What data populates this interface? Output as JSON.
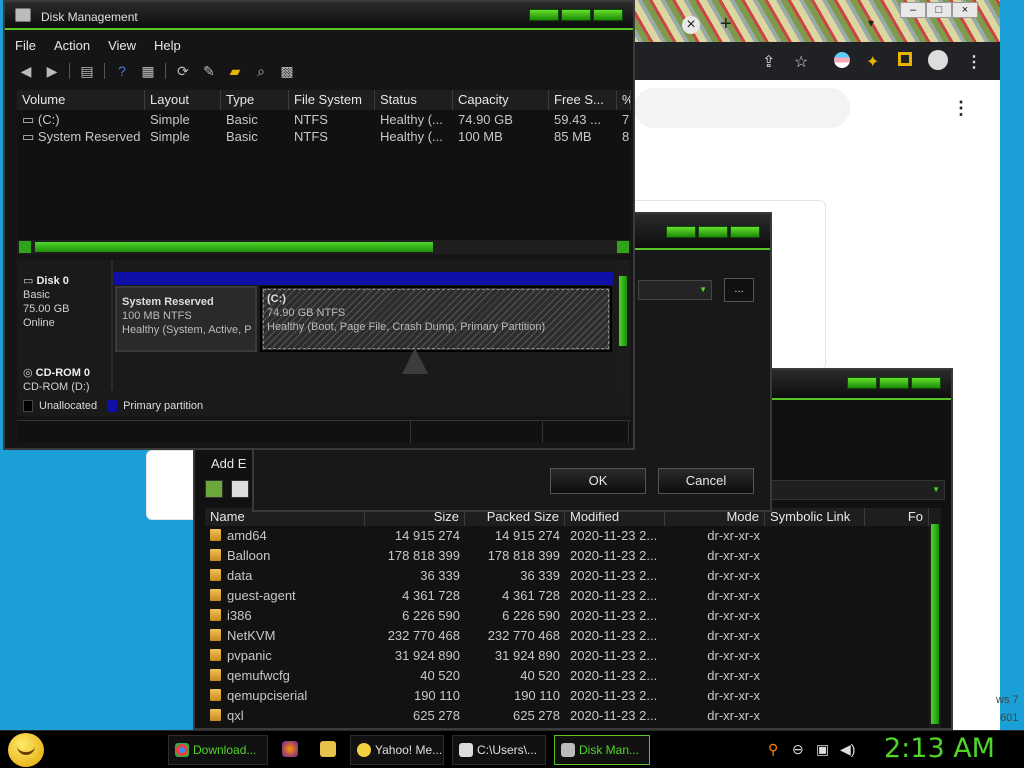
{
  "disk_management": {
    "title": "Disk Management",
    "menu": [
      "File",
      "Action",
      "View",
      "Help"
    ],
    "columns": [
      "Volume",
      "Layout",
      "Type",
      "File System",
      "Status",
      "Capacity",
      "Free S...",
      "%"
    ],
    "rows": [
      [
        "(C:)",
        "Simple",
        "Basic",
        "NTFS",
        "Healthy (...",
        "74.90 GB",
        "59.43 ...",
        "7"
      ],
      [
        "System Reserved",
        "Simple",
        "Basic",
        "NTFS",
        "Healthy (...",
        "100 MB",
        "85 MB",
        "8"
      ]
    ],
    "disk0": {
      "name": "Disk 0",
      "type": "Basic",
      "size": "75.00 GB",
      "state": "Online",
      "partitions": [
        {
          "name": "System Reserved",
          "size": "100 MB NTFS",
          "status": "Healthy (System, Active, P"
        },
        {
          "name": "(C:)",
          "size": "74.90 GB NTFS",
          "status": "Healthy (Boot, Page File, Crash Dump, Primary Partition)"
        }
      ]
    },
    "cdrom": {
      "name": "CD-ROM 0",
      "label": "CD-ROM (D:)"
    },
    "legend": {
      "unallocated": "Unallocated",
      "primary": "Primary partition"
    },
    "colors": {
      "unallocated": "#000000",
      "primary": "#1010a8"
    }
  },
  "dialog": {
    "browse_label": "...",
    "ok_label": "OK",
    "cancel_label": "Cancel"
  },
  "sevenzip": {
    "menu_partial": "Add   E",
    "columns": [
      "Name",
      "Size",
      "Packed Size",
      "Modified",
      "Mode",
      "Symbolic Link",
      "Fo"
    ],
    "files": [
      {
        "name": "amd64",
        "size": "14 915 274",
        "packed": "14 915 274",
        "modified": "2020-11-23 2...",
        "mode": "dr-xr-xr-x"
      },
      {
        "name": "Balloon",
        "size": "178 818 399",
        "packed": "178 818 399",
        "modified": "2020-11-23 2...",
        "mode": "dr-xr-xr-x"
      },
      {
        "name": "data",
        "size": "36 339",
        "packed": "36 339",
        "modified": "2020-11-23 2...",
        "mode": "dr-xr-xr-x"
      },
      {
        "name": "guest-agent",
        "size": "4 361 728",
        "packed": "4 361 728",
        "modified": "2020-11-23 2...",
        "mode": "dr-xr-xr-x"
      },
      {
        "name": "i386",
        "size": "6 226 590",
        "packed": "6 226 590",
        "modified": "2020-11-23 2...",
        "mode": "dr-xr-xr-x"
      },
      {
        "name": "NetKVM",
        "size": "232 770 468",
        "packed": "232 770 468",
        "modified": "2020-11-23 2...",
        "mode": "dr-xr-xr-x"
      },
      {
        "name": "pvpanic",
        "size": "31 924 890",
        "packed": "31 924 890",
        "modified": "2020-11-23 2...",
        "mode": "dr-xr-xr-x"
      },
      {
        "name": "qemufwcfg",
        "size": "40 520",
        "packed": "40 520",
        "modified": "2020-11-23 2...",
        "mode": "dr-xr-xr-x"
      },
      {
        "name": "qemupciserial",
        "size": "190 110",
        "packed": "190 110",
        "modified": "2020-11-23 2...",
        "mode": "dr-xr-xr-x"
      },
      {
        "name": "qxl",
        "size": "625 278",
        "packed": "625 278",
        "modified": "2020-11-23 2...",
        "mode": "dr-xr-xr-x"
      }
    ]
  },
  "desktop": {
    "edge_text_1": "ws 7",
    "edge_text_2": "601"
  },
  "taskbar": {
    "tasks": [
      {
        "label": "Download...",
        "icon": "chrome-icon"
      },
      {
        "label": "Yahoo! Me...",
        "icon": "yahoo-messenger-icon"
      },
      {
        "label": "C:\\Users\\...",
        "icon": "7zip-icon"
      },
      {
        "label": "Disk Man...",
        "icon": "disk-management-icon"
      }
    ],
    "clock": "2:13 AM"
  },
  "theme": {
    "accent": "#4fd52a",
    "window_bg": "#151515"
  }
}
